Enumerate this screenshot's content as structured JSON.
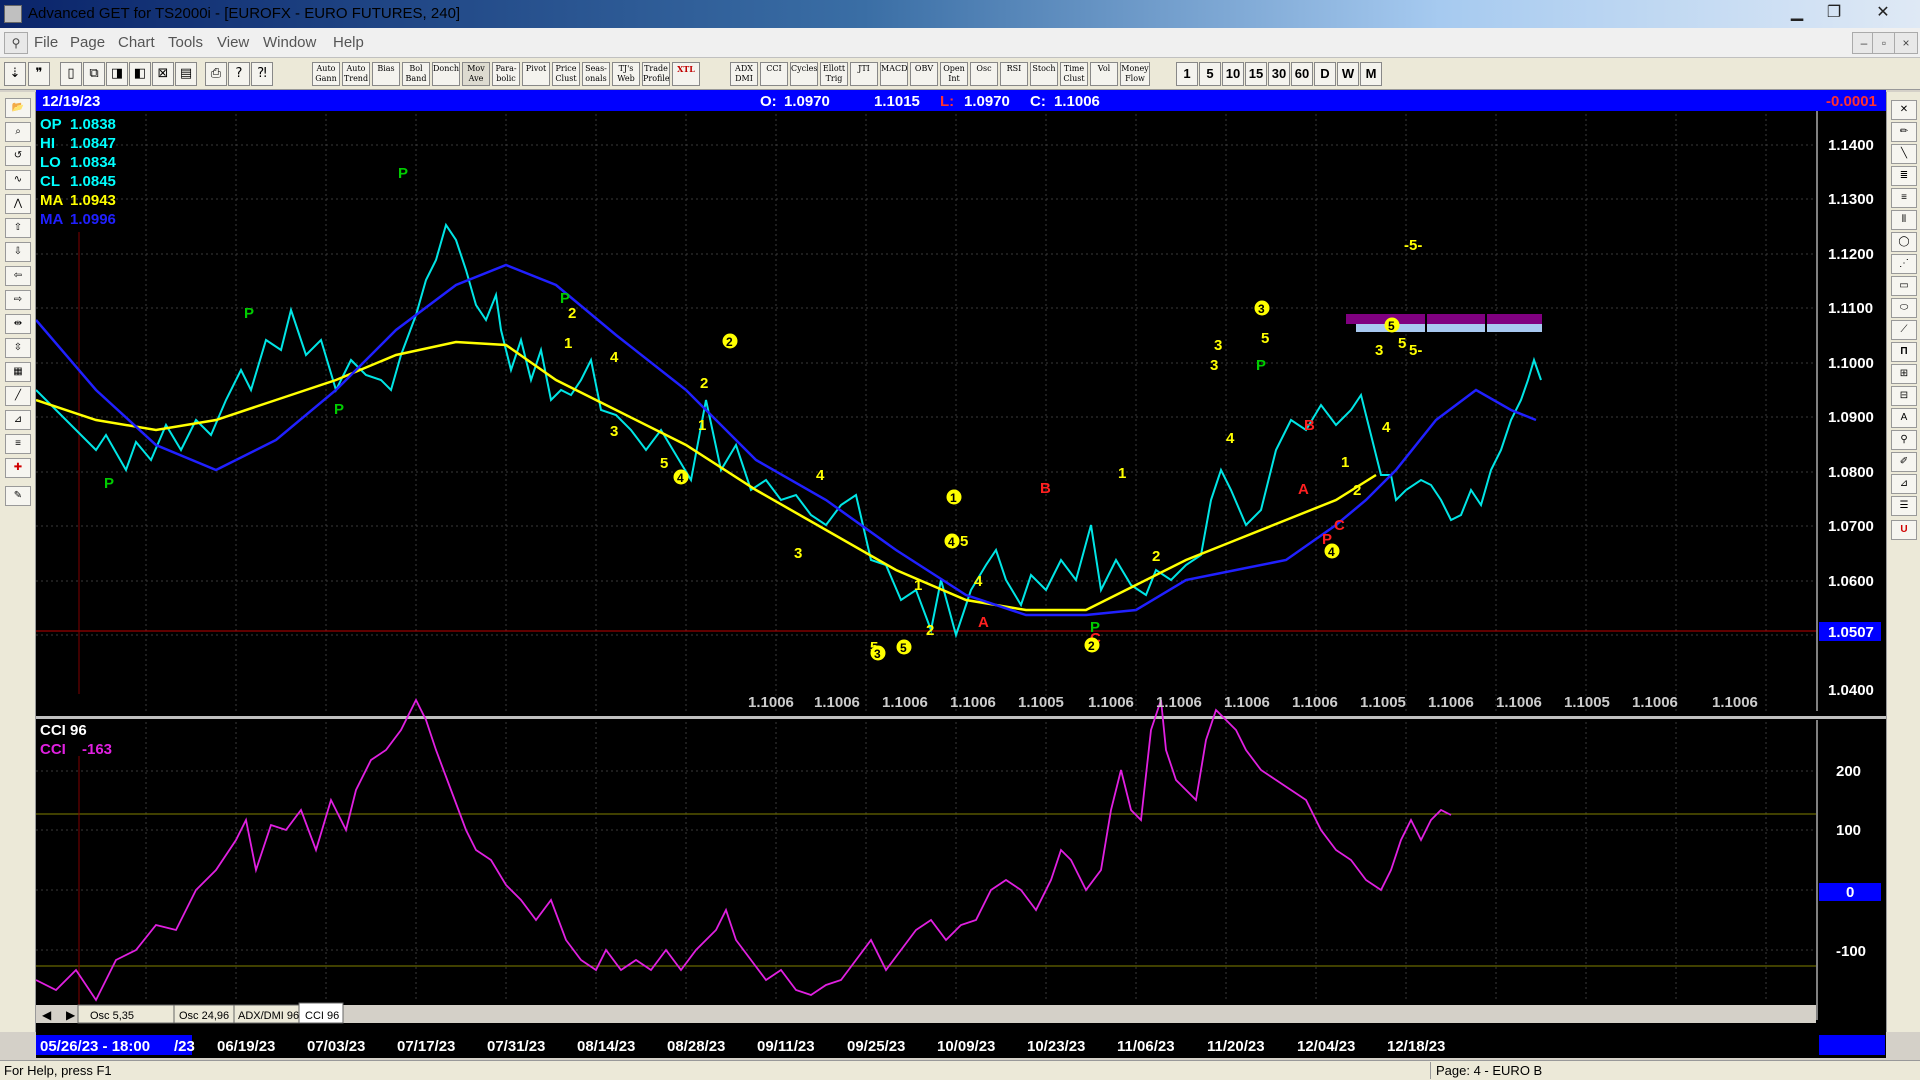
{
  "window": {
    "title": "Advanced GET for TS2000i - [EUROFX - EURO FUTURES, 240]",
    "minimize": "▁",
    "maximize": "❐",
    "close": "✕"
  },
  "menu": [
    "File",
    "Page",
    "Chart",
    "Tools",
    "View",
    "Window",
    "Help"
  ],
  "toolbar": {
    "buttons": [
      "Auto Gann",
      "Auto Trend",
      "Bias",
      "Bol Band",
      "Donch",
      "Mov Ave",
      "Para-bolic",
      "Pivot",
      "Price Clust",
      "Seas-onals",
      "TJ's Web",
      "Trade Profile",
      "XTL",
      "ADX DMI",
      "CCI",
      "Cycles",
      "Ellott Trig",
      "JTI",
      "MACD",
      "OBV",
      "Open Int",
      "Osc",
      "RSI",
      "Stoch",
      "Time Clust",
      "Vol",
      "Money Flow"
    ],
    "timeframes": [
      "1",
      "5",
      "10",
      "15",
      "30",
      "60",
      "D",
      "W",
      "M"
    ]
  },
  "header": {
    "date": "12/19/23",
    "open_label": "O:",
    "open": "1.0970",
    "high": "1.1015",
    "low_label": "L:",
    "low": "1.0970",
    "close_label": "C:",
    "close": "1.1006",
    "change": "-0.0001"
  },
  "colors": {
    "header_bg": "#0000ff",
    "price": "#00e5e5",
    "ma_slow": "#ffff00",
    "ma_fast": "#2020ff",
    "cci": "#e020e0",
    "wave": "#ffff00",
    "pivot": "#00cc00",
    "abc": "#ff2020"
  },
  "readout": [
    {
      "label": "OP",
      "value": "1.0838",
      "color": "#00ffff"
    },
    {
      "label": "HI",
      "value": "1.0847",
      "color": "#00ffff"
    },
    {
      "label": "LO",
      "value": "1.0834",
      "color": "#00ffff"
    },
    {
      "label": "CL",
      "value": "1.0845",
      "color": "#00ffff"
    },
    {
      "label": "MA",
      "value": "1.0943",
      "color": "#ffff00"
    },
    {
      "label": "MA",
      "value": "1.0996",
      "color": "#2020ff"
    }
  ],
  "price_axis": {
    "labels": [
      "1.1400",
      "1.1300",
      "1.1200",
      "1.1100",
      "1.1000",
      "1.0900",
      "1.0800",
      "1.0700",
      "1.0600",
      "1.0400"
    ],
    "marker": "1.0507",
    "bottom_row": [
      "1.1006",
      "1.1006",
      "1.1006",
      "1.1006",
      "1.1005",
      "1.1006",
      "1.1006",
      "1.1006",
      "1.1006",
      "1.1005",
      "1.1006",
      "1.1006",
      "1.1005",
      "1.1006",
      "1.1006"
    ]
  },
  "cci": {
    "title": "CCI 96",
    "label": "CCI",
    "value": "-163",
    "axis": [
      "200",
      "100",
      "0",
      "-100"
    ]
  },
  "tabs": [
    "Osc 5,35",
    "Osc 24,96",
    "ADX/DMI 96",
    "CCI 96"
  ],
  "date_axis": {
    "start": "05/26/23 - 18:00",
    "labels": [
      "/23",
      "06/19/23",
      "07/03/23",
      "07/17/23",
      "07/31/23",
      "08/14/23",
      "08/28/23",
      "09/11/23",
      "09/25/23",
      "10/09/23",
      "10/23/23",
      "11/06/23",
      "11/20/23",
      "12/04/23",
      "12/18/23"
    ]
  },
  "annotations": {
    "waves": [
      "P",
      "P",
      "P",
      "P",
      "P",
      "P",
      "P",
      "1",
      "2",
      "3",
      "4",
      "5",
      "A",
      "B",
      "C",
      "-5-",
      "5-"
    ]
  },
  "status": {
    "help": "For Help, press F1",
    "page": "Page: 4 - EURO B"
  }
}
